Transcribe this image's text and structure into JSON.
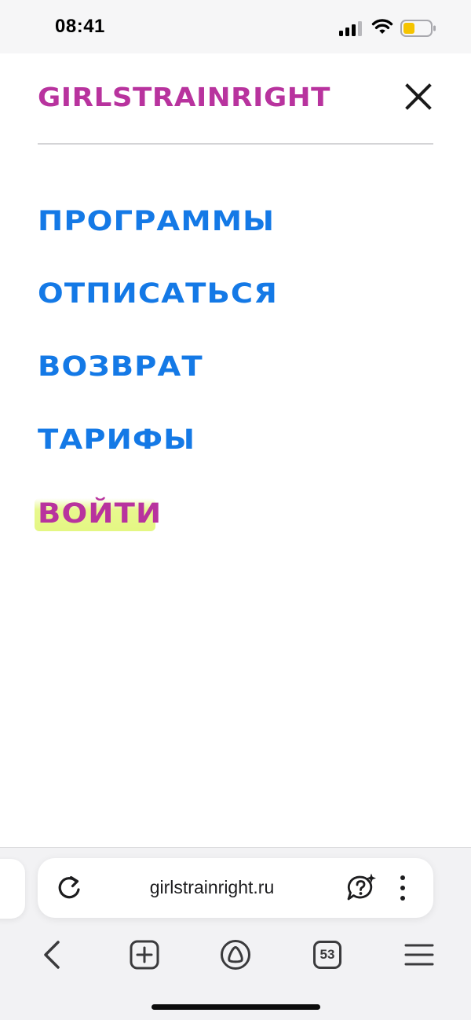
{
  "status_bar": {
    "time": "08:41",
    "battery_color": "#f5c400"
  },
  "header": {
    "brand": "GIRLSTRAINRIGHT",
    "brand_color": "#b8339e"
  },
  "menu": {
    "items": [
      {
        "label": "ПРОГРАММЫ"
      },
      {
        "label": "ОТПИСАТЬСЯ"
      },
      {
        "label": "ВОЗВРАТ"
      },
      {
        "label": "ТАРИФЫ"
      }
    ],
    "login_label": "ВОЙТИ",
    "item_color": "#1479e6",
    "login_highlight_color": "#e4f783"
  },
  "browser": {
    "url": "girlstrainright.ru",
    "tab_count": "53"
  }
}
